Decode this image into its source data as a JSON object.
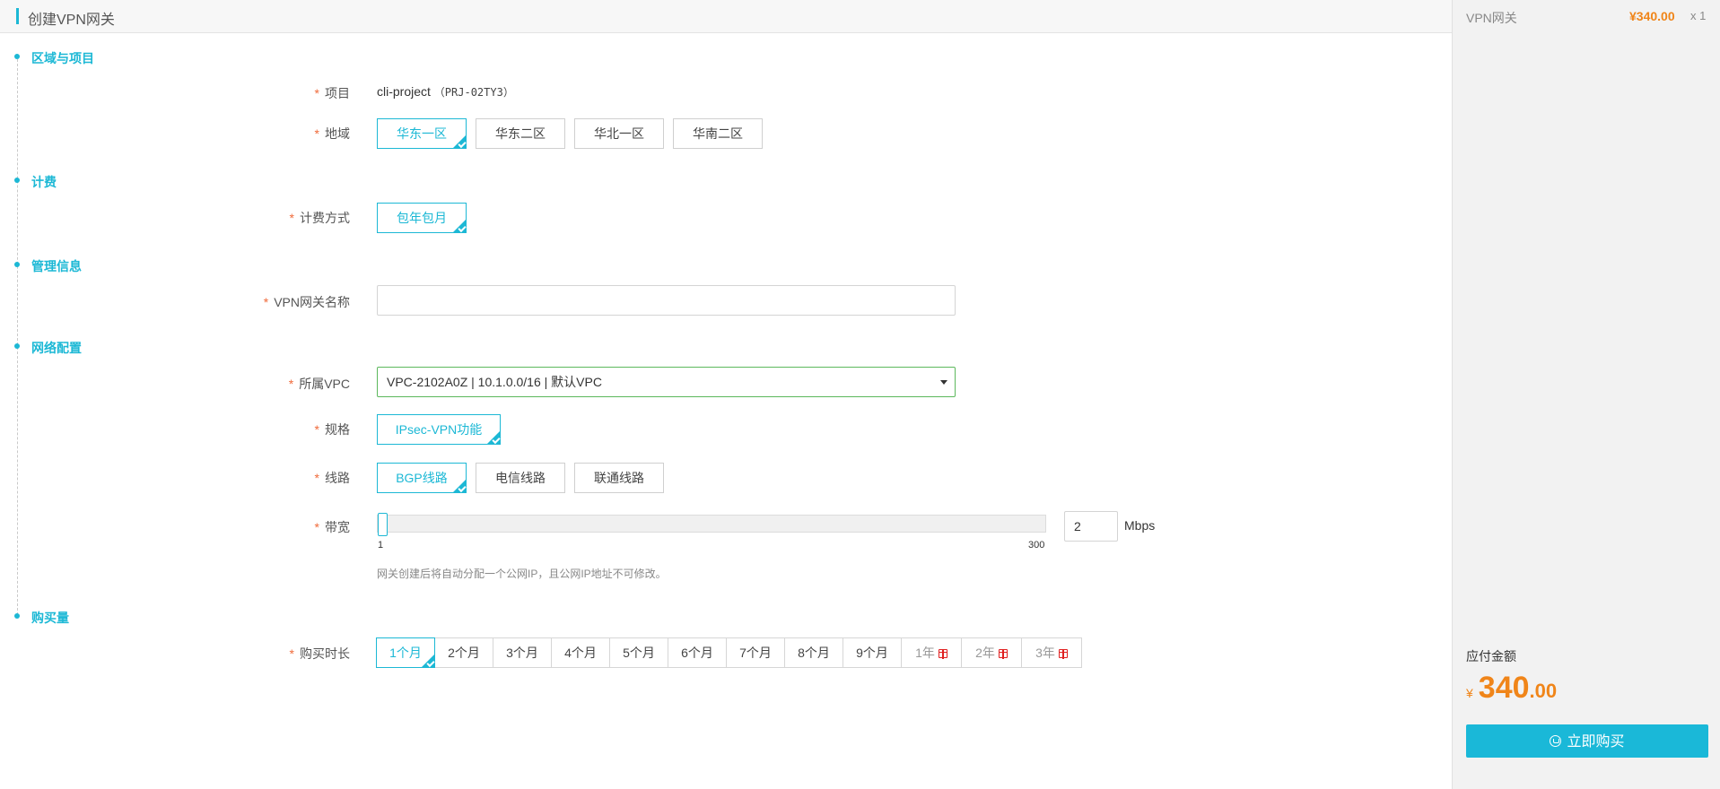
{
  "header": {
    "title": "创建VPN网关"
  },
  "sections": {
    "region": "区域与项目",
    "billing": "计费",
    "management": "管理信息",
    "network": "网络配置",
    "purchase": "购买量"
  },
  "labels": {
    "required_mark": "*",
    "project": "项目",
    "region": "地域",
    "billing_method": "计费方式",
    "gateway_name": "VPN网关名称",
    "vpc": "所属VPC",
    "spec": "规格",
    "line": "线路",
    "bandwidth": "带宽",
    "duration": "购买时长"
  },
  "project": {
    "name": "cli-project",
    "id": "（PRJ-02TY3）"
  },
  "regions": [
    {
      "label": "华东一区",
      "selected": true
    },
    {
      "label": "华东二区",
      "selected": false
    },
    {
      "label": "华北一区",
      "selected": false
    },
    {
      "label": "华南二区",
      "selected": false
    }
  ],
  "billing": {
    "option": "包年包月"
  },
  "gateway_name": {
    "value": "",
    "placeholder": ""
  },
  "vpc": {
    "selected": "VPC-2102A0Z | 10.1.0.0/16 | 默认VPC"
  },
  "spec": {
    "option": "IPsec-VPN功能"
  },
  "lines": [
    {
      "label": "BGP线路",
      "selected": true
    },
    {
      "label": "电信线路",
      "selected": false
    },
    {
      "label": "联通线路",
      "selected": false
    }
  ],
  "bandwidth": {
    "min": "1",
    "max": "300",
    "value": "2",
    "level": 2,
    "unit": "Mbps",
    "hint": "网关创建后将自动分配一个公网IP，且公网IP地址不可修改。"
  },
  "durations": [
    {
      "label": "1个月",
      "selected": true,
      "gift": false
    },
    {
      "label": "2个月",
      "selected": false,
      "gift": false
    },
    {
      "label": "3个月",
      "selected": false,
      "gift": false
    },
    {
      "label": "4个月",
      "selected": false,
      "gift": false
    },
    {
      "label": "5个月",
      "selected": false,
      "gift": false
    },
    {
      "label": "6个月",
      "selected": false,
      "gift": false
    },
    {
      "label": "7个月",
      "selected": false,
      "gift": false
    },
    {
      "label": "8个月",
      "selected": false,
      "gift": false
    },
    {
      "label": "9个月",
      "selected": false,
      "gift": false
    },
    {
      "label": "1年",
      "selected": false,
      "gift": true
    },
    {
      "label": "2年",
      "selected": false,
      "gift": true
    },
    {
      "label": "3年",
      "selected": false,
      "gift": true
    }
  ],
  "summary": {
    "item_name": "VPN网关",
    "item_price": "¥340.00",
    "item_qty": "x 1",
    "due_label": "应付金额",
    "currency": "¥",
    "amount_int": "340",
    "amount_dec": ".00",
    "buy_label": "立即购买",
    "icon": "cart-icon"
  },
  "colors": {
    "accent": "#1cb8d5",
    "price": "#f08519",
    "required": "#f06a3a",
    "gift": "#e02020"
  }
}
